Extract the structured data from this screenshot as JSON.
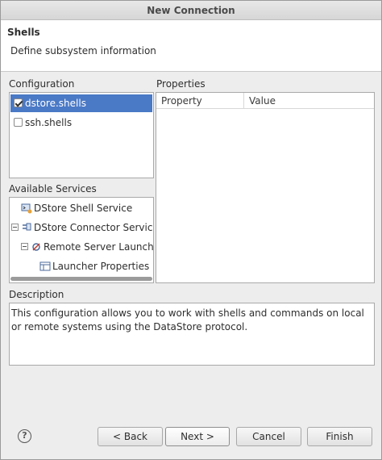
{
  "window": {
    "title": "New Connection"
  },
  "header": {
    "title": "Shells",
    "description": "Define subsystem information"
  },
  "configuration": {
    "label": "Configuration",
    "items": [
      {
        "label": "dstore.shells",
        "checked": true,
        "selected": true
      },
      {
        "label": "ssh.shells",
        "checked": false,
        "selected": false
      }
    ]
  },
  "properties": {
    "label": "Properties",
    "columns": [
      "Property",
      "Value"
    ]
  },
  "services": {
    "label": "Available Services",
    "items": [
      {
        "label": "DStore Shell Service",
        "icon": "shell-service-icon"
      },
      {
        "label": "DStore Connector Service",
        "icon": "connector-service-icon",
        "expanded": true
      },
      {
        "label": "Remote Server Launcher",
        "icon": "launcher-icon",
        "expanded": true
      },
      {
        "label": "Launcher Properties",
        "icon": "properties-icon"
      }
    ]
  },
  "description": {
    "label": "Description",
    "text": "This configuration allows you to work with shells and commands on local or remote systems using the DataStore protocol."
  },
  "buttons": {
    "help": "?",
    "back": "< Back",
    "next": "Next >",
    "cancel": "Cancel",
    "finish": "Finish"
  }
}
